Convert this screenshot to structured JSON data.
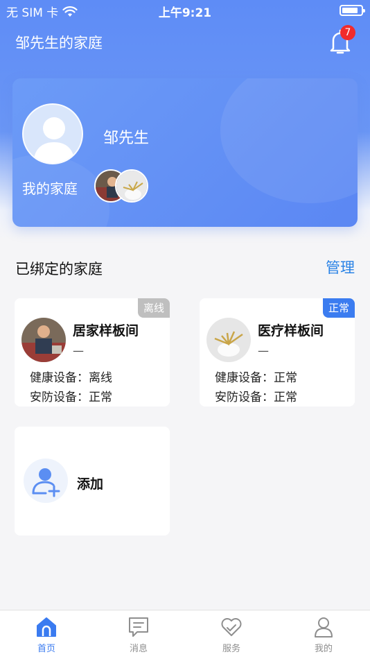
{
  "status_bar": {
    "carrier": "无 SIM 卡",
    "time": "上午9:21",
    "battery_level": 0.85
  },
  "nav": {
    "title": "邹先生的家庭",
    "notification_count": "7"
  },
  "profile": {
    "name": "邹先生",
    "family_label": "我的家庭"
  },
  "section": {
    "title": "已绑定的家庭",
    "manage_label": "管理"
  },
  "families": [
    {
      "name": "居家样板间",
      "subtitle": "—",
      "status_tag": "离线",
      "tag_color": "#bfbfbf",
      "health_label": "健康设备：",
      "health_value": "离线",
      "security_label": "安防设备：",
      "security_value": "正常"
    },
    {
      "name": "医疗样板间",
      "subtitle": "—",
      "status_tag": "正常",
      "tag_color": "#3b7cf0",
      "health_label": "健康设备：",
      "health_value": "正常",
      "security_label": "安防设备：",
      "security_value": "正常"
    }
  ],
  "add_card": {
    "label": "添加"
  },
  "tabs": [
    {
      "label": "首页",
      "icon": "home-icon",
      "active": true
    },
    {
      "label": "消息",
      "icon": "message-icon",
      "active": false
    },
    {
      "label": "服务",
      "icon": "heart-icon",
      "active": false
    },
    {
      "label": "我的",
      "icon": "user-icon",
      "active": false
    }
  ],
  "colors": {
    "primary": "#5e8cf6",
    "accent_link": "#2a83e6",
    "badge": "#f12b2b",
    "tab_active": "#3a7bf0"
  }
}
